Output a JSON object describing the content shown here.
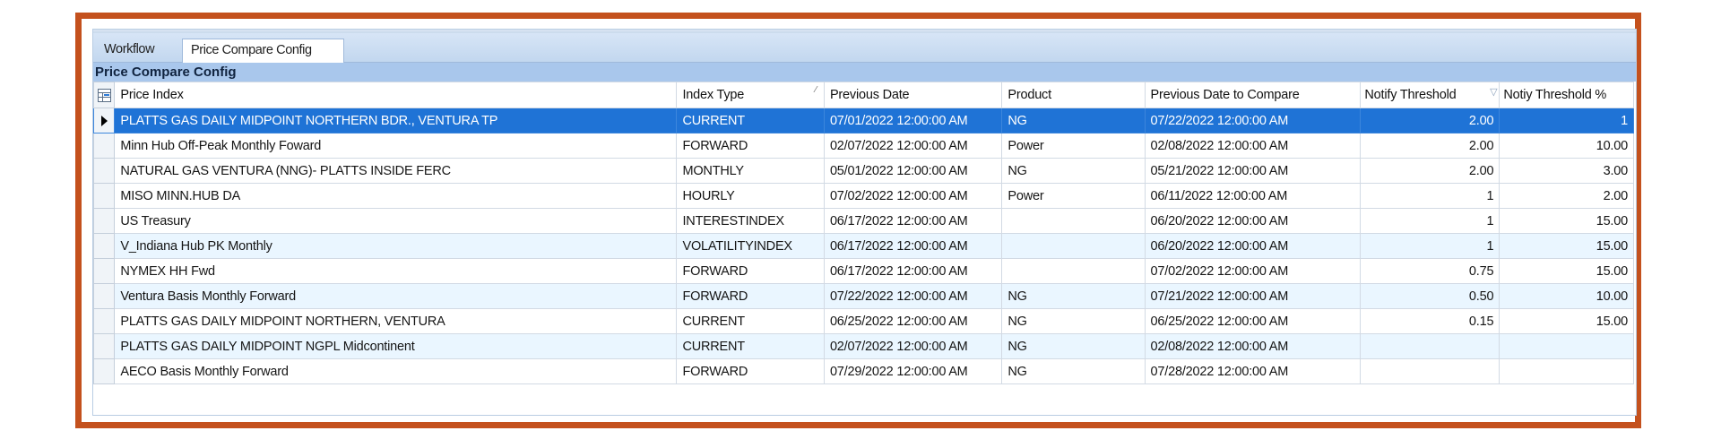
{
  "tabs": [
    {
      "label": "Workflow"
    },
    {
      "label": "Price Compare Config"
    }
  ],
  "section_title": "Price Compare Config",
  "columns": {
    "price_index": "Price Index",
    "index_type": "Index Type",
    "previous_date": "Previous Date",
    "product": "Product",
    "previous_date_to_compare": "Previous Date to Compare",
    "notify_threshold": "Notify Threshold",
    "notiy_threshold_pct": "Notiy Threshold %"
  },
  "rows": [
    {
      "price_index": "PLATTS GAS DAILY MIDPOINT NORTHERN BDR., VENTURA TP",
      "index_type": "CURRENT",
      "previous_date": "07/01/2022 12:00:00 AM",
      "product": "NG",
      "previous_date_to_compare": "07/22/2022 12:00:00 AM",
      "notify_threshold": "2.00",
      "notiy_threshold_pct": "1"
    },
    {
      "price_index": "Minn Hub Off-Peak Monthly Foward",
      "index_type": "FORWARD",
      "previous_date": "02/07/2022 12:00:00 AM",
      "product": "Power",
      "previous_date_to_compare": "02/08/2022 12:00:00 AM",
      "notify_threshold": "2.00",
      "notiy_threshold_pct": "10.00"
    },
    {
      "price_index": "NATURAL GAS VENTURA (NNG)- PLATTS INSIDE FERC",
      "index_type": "MONTHLY",
      "previous_date": "05/01/2022 12:00:00 AM",
      "product": "NG",
      "previous_date_to_compare": "05/21/2022 12:00:00 AM",
      "notify_threshold": "2.00",
      "notiy_threshold_pct": "3.00"
    },
    {
      "price_index": "MISO MINN.HUB DA",
      "index_type": "HOURLY",
      "previous_date": "07/02/2022 12:00:00 AM",
      "product": "Power",
      "previous_date_to_compare": "06/11/2022 12:00:00 AM",
      "notify_threshold": "1",
      "notiy_threshold_pct": "2.00"
    },
    {
      "price_index": "US Treasury",
      "index_type": "INTERESTINDEX",
      "previous_date": "06/17/2022 12:00:00 AM",
      "product": "",
      "previous_date_to_compare": "06/20/2022 12:00:00 AM",
      "notify_threshold": "1",
      "notiy_threshold_pct": "15.00"
    },
    {
      "price_index": "V_Indiana Hub PK Monthly",
      "index_type": "VOLATILITYINDEX",
      "previous_date": "06/17/2022 12:00:00 AM",
      "product": "",
      "previous_date_to_compare": "06/20/2022 12:00:00 AM",
      "notify_threshold": "1",
      "notiy_threshold_pct": "15.00"
    },
    {
      "price_index": "NYMEX HH Fwd",
      "index_type": "FORWARD",
      "previous_date": "06/17/2022 12:00:00 AM",
      "product": "",
      "previous_date_to_compare": "07/02/2022 12:00:00 AM",
      "notify_threshold": "0.75",
      "notiy_threshold_pct": "15.00"
    },
    {
      "price_index": "Ventura Basis Monthly Forward",
      "index_type": "FORWARD",
      "previous_date": "07/22/2022 12:00:00 AM",
      "product": "NG",
      "previous_date_to_compare": "07/21/2022 12:00:00 AM",
      "notify_threshold": "0.50",
      "notiy_threshold_pct": "10.00"
    },
    {
      "price_index": "PLATTS GAS DAILY MIDPOINT NORTHERN, VENTURA",
      "index_type": "CURRENT",
      "previous_date": "06/25/2022 12:00:00 AM",
      "product": "NG",
      "previous_date_to_compare": "06/25/2022 12:00:00 AM",
      "notify_threshold": "0.15",
      "notiy_threshold_pct": "15.00"
    },
    {
      "price_index": "PLATTS GAS DAILY MIDPOINT NGPL Midcontinent",
      "index_type": "CURRENT",
      "previous_date": "02/07/2022 12:00:00 AM",
      "product": "NG",
      "previous_date_to_compare": "02/08/2022 12:00:00 AM",
      "notify_threshold": "",
      "notiy_threshold_pct": ""
    },
    {
      "price_index": "AECO Basis Monthly Forward",
      "index_type": "FORWARD",
      "previous_date": "07/29/2022 12:00:00 AM",
      "product": "NG",
      "previous_date_to_compare": "07/28/2022 12:00:00 AM",
      "notify_threshold": "",
      "notiy_threshold_pct": ""
    }
  ],
  "icons": {
    "column_chooser": "column-chooser-icon",
    "row_indicator": "row-pointer-icon",
    "sort": "sort-ascending-icon",
    "filter": "filter-icon"
  },
  "colors": {
    "frame": "#c4511d",
    "selected_row": "#1f73d6",
    "alt_row": "#eaf6ff",
    "section_header": "#a9c7ec"
  }
}
